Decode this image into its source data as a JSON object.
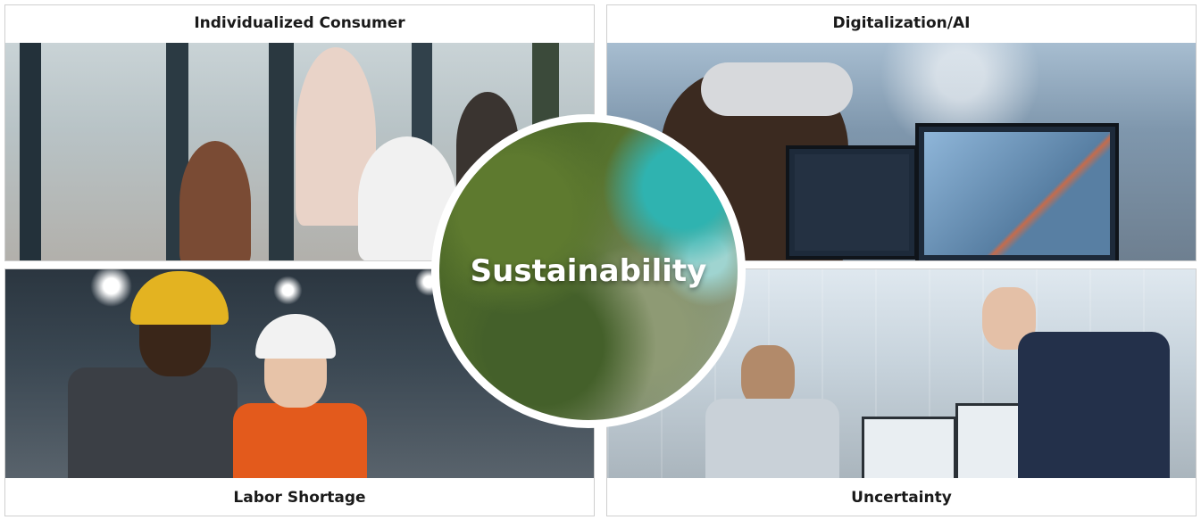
{
  "quadrants": {
    "top_left": {
      "label": "Individualized Consumer"
    },
    "top_right": {
      "label": "Digitalization/AI"
    },
    "bottom_left": {
      "label": "Labor Shortage"
    },
    "bottom_right": {
      "label": "Uncertainty"
    }
  },
  "center": {
    "label": "Sustainability"
  }
}
